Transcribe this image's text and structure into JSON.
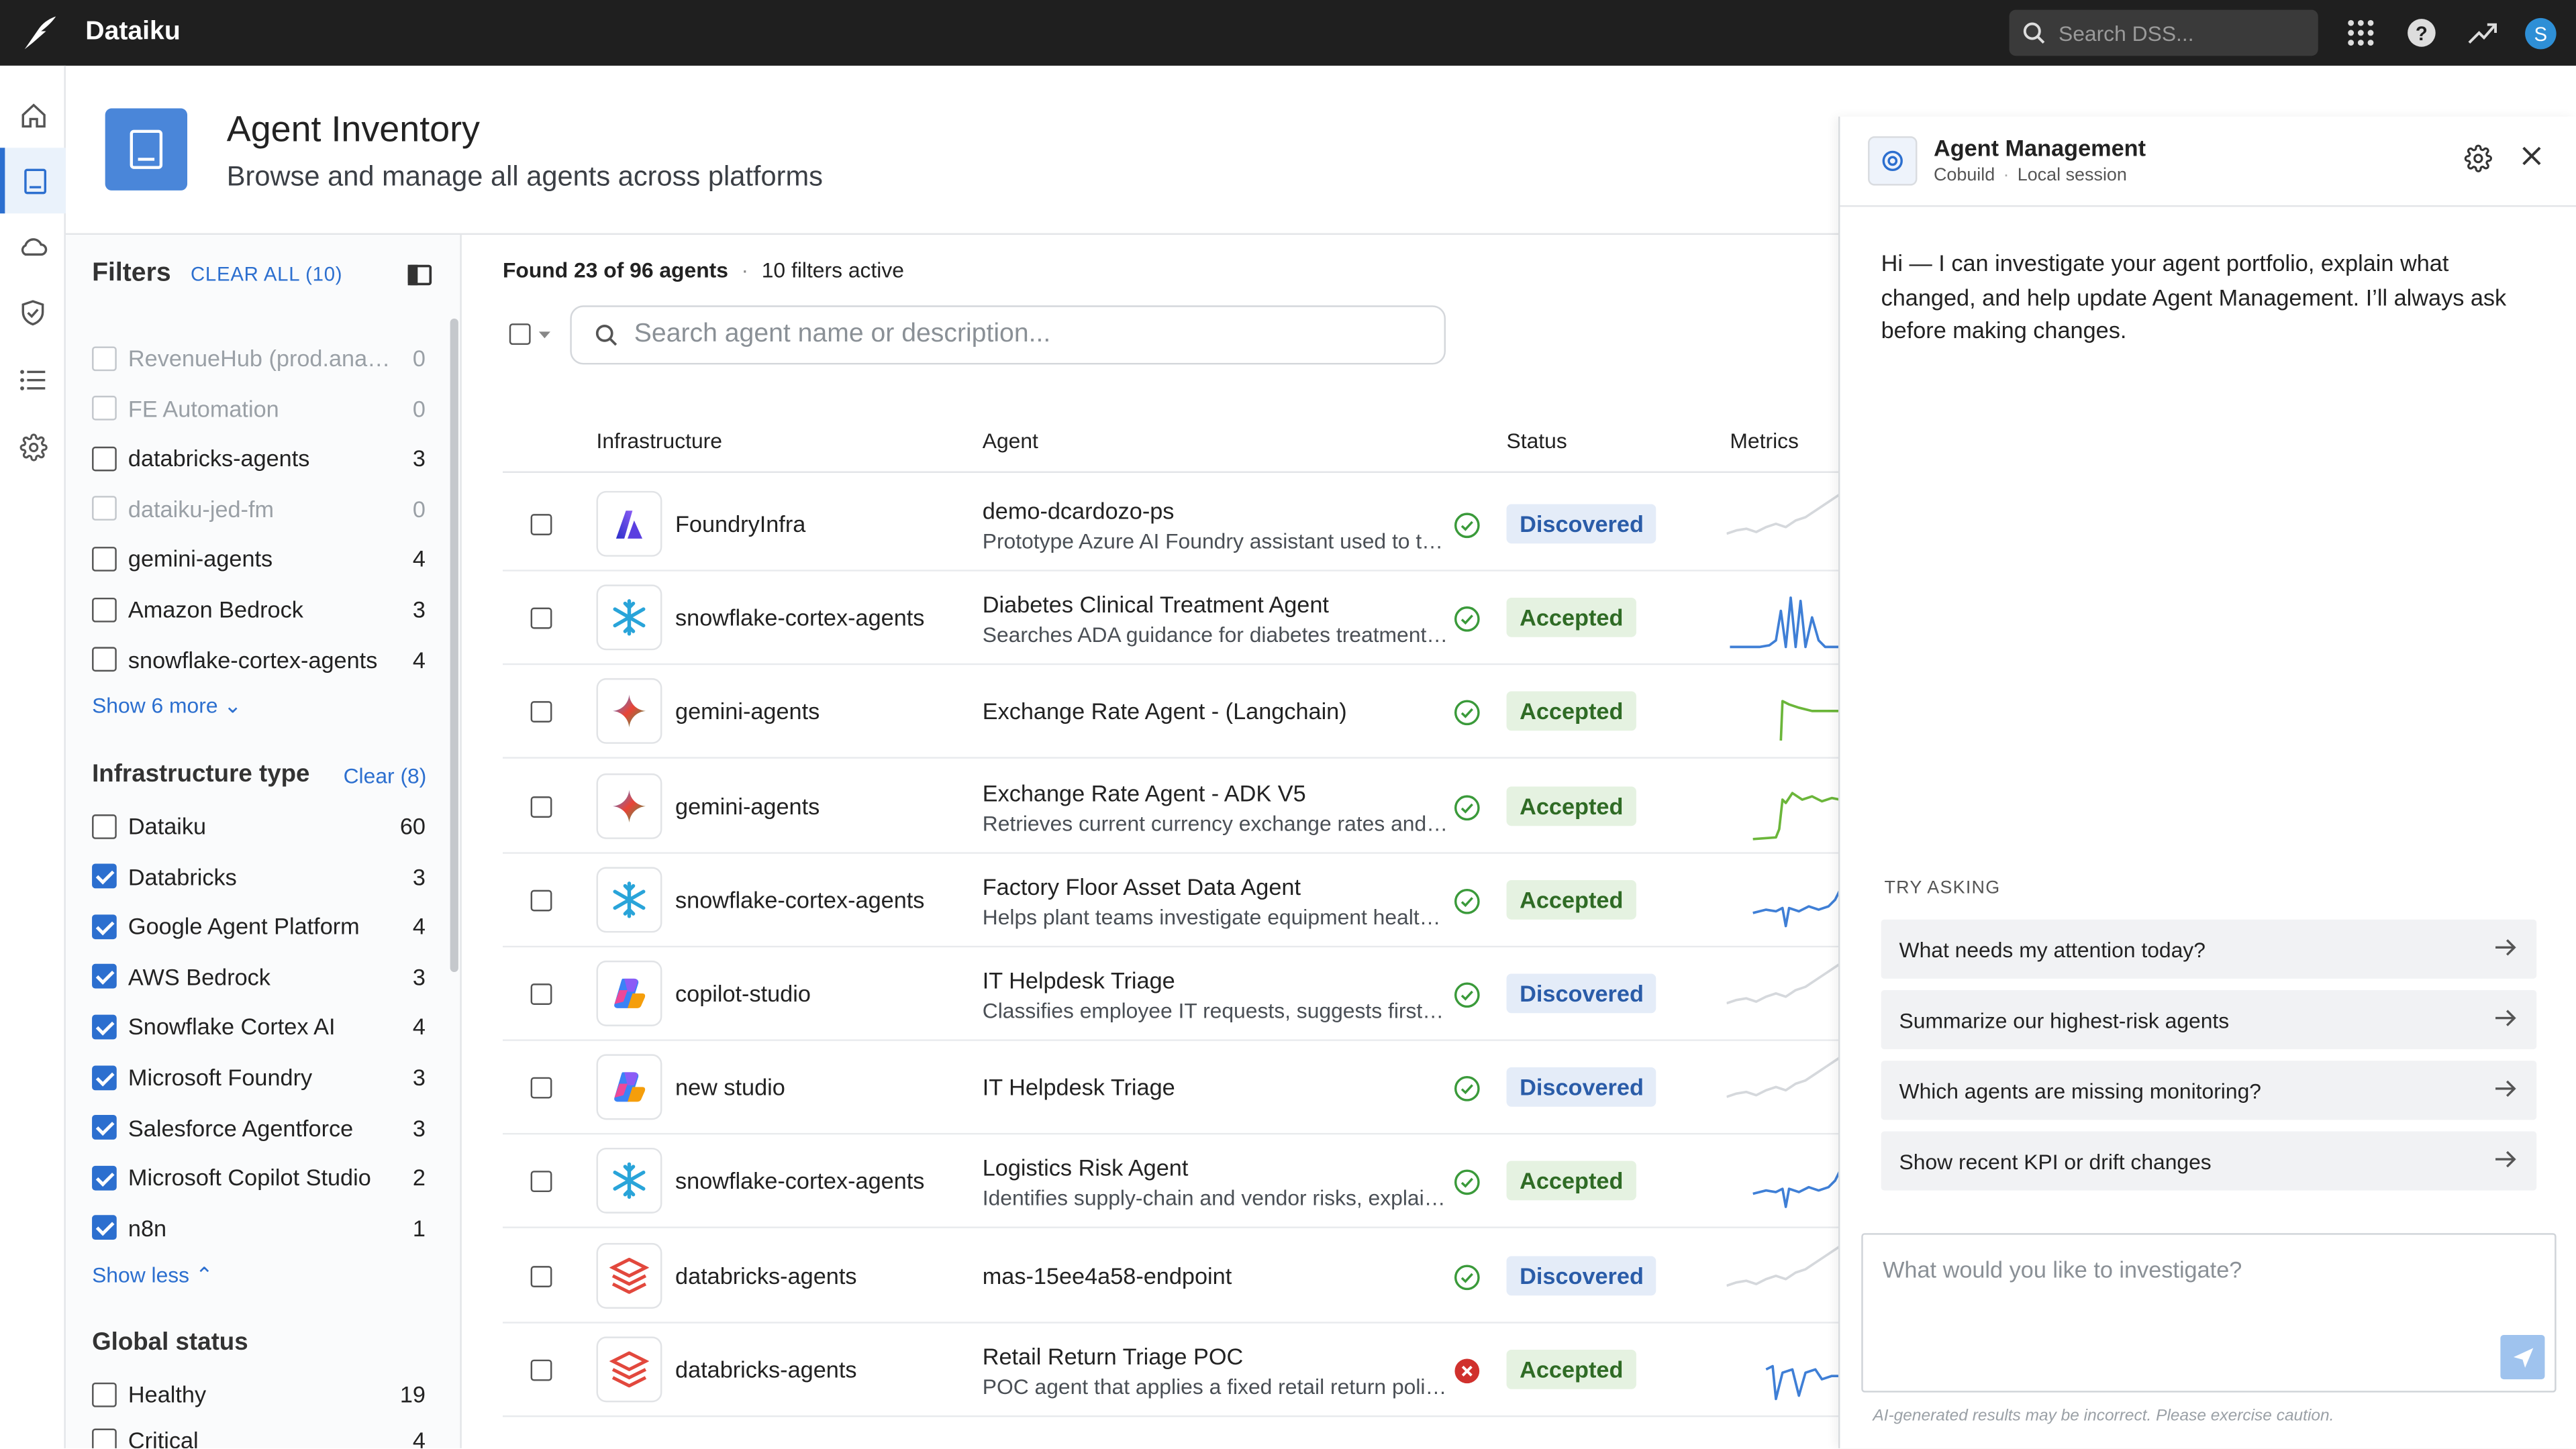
{
  "app": {
    "title": "Dataiku",
    "search_placeholder": "Search DSS...",
    "user_initial": "S"
  },
  "header": {
    "title": "Agent Inventory",
    "subtitle": "Browse and manage all agents across platforms"
  },
  "filters": {
    "title": "Filters",
    "clear_all": "CLEAR ALL (10)",
    "projects": [
      {
        "label": "RevenueHub (prod.analy…",
        "count": "0",
        "checked": false,
        "dim": true
      },
      {
        "label": "FE Automation",
        "count": "0",
        "checked": false,
        "dim": true
      },
      {
        "label": "databricks-agents",
        "count": "3",
        "checked": false,
        "dim": false
      },
      {
        "label": "dataiku-jed-fm",
        "count": "0",
        "checked": false,
        "dim": true
      },
      {
        "label": "gemini-agents",
        "count": "4",
        "checked": false,
        "dim": false
      },
      {
        "label": "Amazon Bedrock",
        "count": "3",
        "checked": false,
        "dim": false
      },
      {
        "label": "snowflake-cortex-agents",
        "count": "4",
        "checked": false,
        "dim": false
      }
    ],
    "show_more": "Show 6 more",
    "infra_type": {
      "title": "Infrastructure type",
      "clear": "Clear (8)",
      "items": [
        {
          "label": "Dataiku",
          "count": "60",
          "checked": false
        },
        {
          "label": "Databricks",
          "count": "3",
          "checked": true
        },
        {
          "label": "Google Agent Platform",
          "count": "4",
          "checked": true
        },
        {
          "label": "AWS Bedrock",
          "count": "3",
          "checked": true
        },
        {
          "label": "Snowflake Cortex AI",
          "count": "4",
          "checked": true
        },
        {
          "label": "Microsoft Foundry",
          "count": "3",
          "checked": true
        },
        {
          "label": "Salesforce Agentforce",
          "count": "3",
          "checked": true
        },
        {
          "label": "Microsoft Copilot Studio",
          "count": "2",
          "checked": true
        },
        {
          "label": "n8n",
          "count": "1",
          "checked": true
        }
      ],
      "show_less": "Show less"
    },
    "global_status": {
      "title": "Global status",
      "items": [
        {
          "label": "Healthy",
          "count": "19",
          "checked": false
        },
        {
          "label": "Critical",
          "count": "4",
          "checked": false
        }
      ]
    }
  },
  "results": {
    "found": "Found 23 of 96 agents",
    "filters_active": "10 filters active",
    "search_placeholder": "Search agent name or description..."
  },
  "table": {
    "headers": {
      "infrastructure": "Infrastructure",
      "agent": "Agent",
      "status": "Status",
      "metrics": "Metrics"
    },
    "rows": [
      {
        "infra": "FoundryInfra",
        "icon": "foundry-icon",
        "agent": "demo-dcardozo-ps",
        "desc": "Prototype Azure AI Foundry assistant used to test…",
        "health": "ok",
        "status": "Discovered",
        "spark": "faint-up"
      },
      {
        "infra": "snowflake-cortex-agents",
        "icon": "snowflake-icon",
        "agent": "Diabetes Clinical Treatment Agent",
        "desc": "Searches ADA guidance for diabetes treatment in…",
        "health": "ok",
        "status": "Accepted",
        "spark": "spiky"
      },
      {
        "infra": "gemini-agents",
        "icon": "gemini-icon",
        "agent": "Exchange Rate Agent - (Langchain)",
        "desc": "",
        "health": "ok",
        "status": "Accepted",
        "spark": "green-step"
      },
      {
        "infra": "gemini-agents",
        "icon": "gemini-icon",
        "agent": "Exchange Rate Agent - ADK V5",
        "desc": "Retrieves current currency exchange rates and pr…",
        "health": "ok",
        "status": "Accepted",
        "spark": "green-rise"
      },
      {
        "infra": "snowflake-cortex-agents",
        "icon": "snowflake-icon",
        "agent": "Factory Floor Asset Data Agent",
        "desc": "Helps plant teams investigate equipment health,…",
        "health": "ok",
        "status": "Accepted",
        "spark": "blue-dip"
      },
      {
        "infra": "copilot-studio",
        "icon": "copilot-icon",
        "agent": "IT Helpdesk Triage",
        "desc": "Classifies employee IT requests, suggests first-lin…",
        "health": "ok",
        "status": "Discovered",
        "spark": "faint-up"
      },
      {
        "infra": "new studio",
        "icon": "copilot-icon",
        "agent": "IT Helpdesk Triage",
        "desc": "",
        "health": "ok",
        "status": "Discovered",
        "spark": "faint-up"
      },
      {
        "infra": "snowflake-cortex-agents",
        "icon": "snowflake-icon",
        "agent": "Logistics Risk Agent",
        "desc": "Identifies supply-chain and vendor risks, explain…",
        "health": "ok",
        "status": "Accepted",
        "spark": "blue-dip"
      },
      {
        "infra": "databricks-agents",
        "icon": "databricks-icon",
        "agent": "mas-15ee4a58-endpoint",
        "desc": "",
        "health": "ok",
        "status": "Discovered",
        "spark": "faint-up"
      },
      {
        "infra": "databricks-agents",
        "icon": "databricks-icon",
        "agent": "Retail Return Triage POC",
        "desc": "POC agent that applies a fixed retail return policy…",
        "health": "error",
        "status": "Accepted",
        "spark": "blue-wave"
      }
    ]
  },
  "panel": {
    "title": "Agent Management",
    "sub_left": "Cobuild",
    "sub_right": "Local session",
    "message": "Hi — I can investigate your agent portfolio, explain what changed, and help update Agent Management. I’ll always ask before making changes.",
    "try_label": "TRY ASKING",
    "suggestions": [
      "What needs my attention today?",
      "Summarize our highest-risk agents",
      "Which agents are missing monitoring?",
      "Show recent KPI or drift changes"
    ],
    "composer_placeholder": "What would you like to investigate?",
    "disclaimer": "AI-generated results may be incorrect. Please exercise caution."
  },
  "colors": {
    "accent": "#2c6fcf",
    "topbar": "#1f1f1f",
    "accepted_bg": "#e5f2e1",
    "discovered_bg": "#e4ecf8"
  }
}
